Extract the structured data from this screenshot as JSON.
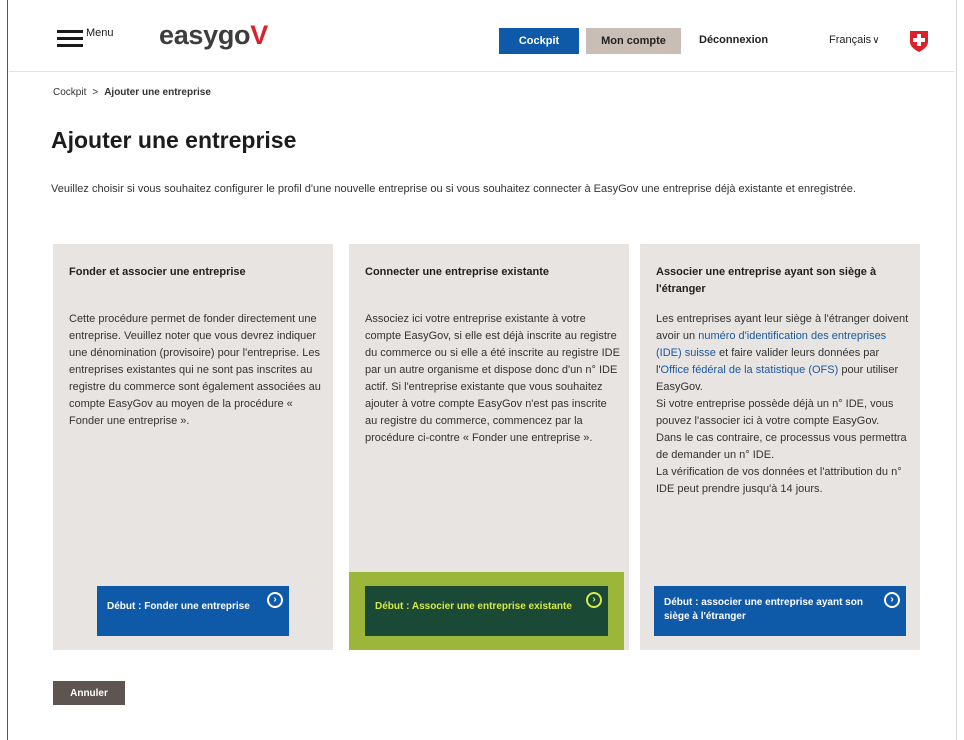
{
  "header": {
    "menu_label": "Menu",
    "logo_text": "easygo",
    "logo_accent": "V",
    "cockpit_label": "Cockpit",
    "account_label": "Mon compte",
    "logout_label": "Déconnexion",
    "language_label": "Français",
    "accent_color": "#0f5aa8",
    "brand_red": "#d8232a"
  },
  "breadcrumb": {
    "home": "Cockpit",
    "separator": ">",
    "current": "Ajouter une entreprise"
  },
  "page": {
    "title": "Ajouter une entreprise",
    "intro": "Veuillez choisir si vous souhaitez configurer le profil d'une nouvelle entreprise ou si vous souhaitez connecter à EasyGov une entreprise déjà existante et enregistrée."
  },
  "cards": [
    {
      "title": "Fonder et associer une entreprise",
      "body": "Cette procédure permet de fonder directement une entreprise. Veuillez noter que vous devrez indiquer une dénomination (provisoire) pour l'entreprise. Les entreprises existantes qui ne sont pas inscrites au registre du commerce sont également associées au compte EasyGov au moyen de la procédure « Fonder une entreprise ».",
      "button": "Début : Fonder une entreprise"
    },
    {
      "title": "Connecter une entreprise existante",
      "body": "Associez ici votre entreprise existante à votre compte EasyGov, si elle est déjà inscrite au registre du commerce ou si elle a été inscrite au registre IDE par un autre organisme et dispose donc d'un n° IDE actif. Si l'entreprise existante que vous souhaitez ajouter à votre compte EasyGov n'est pas inscrite au registre du commerce, commencez par la procédure ci-contre « Fonder une entreprise ».",
      "button": "Début : Associer une entreprise existante"
    },
    {
      "title": "Associer une entreprise ayant son siège à l'étranger",
      "body_part1": "Les entreprises ayant leur siège à l'étranger doivent avoir un ",
      "link1": "numéro d'identification des entreprises (IDE) suisse",
      "body_part2": " et faire valider leurs données par l'",
      "link2": "Office fédéral de la statistique (OFS)",
      "body_part3": " pour utiliser EasyGov.",
      "body_part4": "Si votre entreprise possède déjà un n° IDE, vous pouvez l'associer ici à votre compte EasyGov.",
      "body_part5": "Dans le cas contraire, ce processus vous permettra de demander un n° IDE.",
      "body_part6": "La vérification de vos données et l'attribution du n° IDE peut prendre jusqu'à 14 jours.",
      "button": "Début : associer une entreprise ayant son siège à l'étranger"
    }
  ],
  "cancel_label": "Annuler"
}
